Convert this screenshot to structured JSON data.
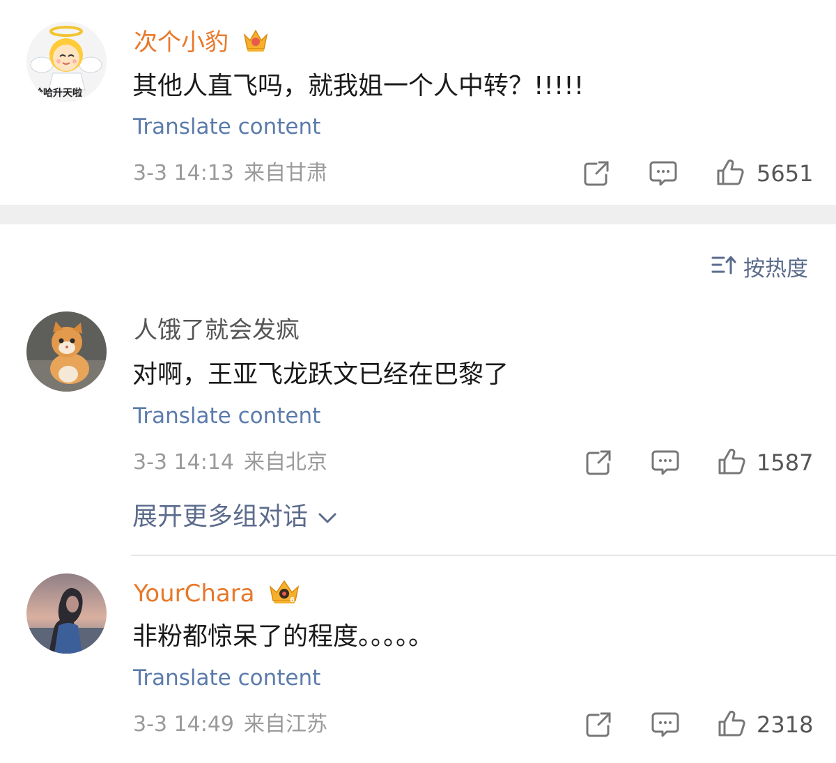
{
  "comments": [
    {
      "username": "次个小豹",
      "avatar_caption": "哈哈升天啦",
      "text": "其他人直飞吗，就我姐一个人中转？!!!!!",
      "translate": "Translate content",
      "time": "3-3 14:13",
      "location": "来自甘肃",
      "likes": "5651",
      "vip": true
    },
    {
      "username": "人饿了就会发疯",
      "text": "对啊，王亚飞龙跃文已经在巴黎了",
      "translate": "Translate content",
      "time": "3-3 14:14",
      "location": "来自北京",
      "likes": "1587",
      "vip": false
    },
    {
      "username": "YourChara",
      "crown_level": "6",
      "text": "非粉都惊呆了的程度。。。。。",
      "translate": "Translate content",
      "time": "3-3 14:49",
      "location": "来自江苏",
      "likes": "2318",
      "vip": true
    }
  ],
  "sort": {
    "label": "按热度",
    "icon": "sort-icon"
  },
  "expand_more": {
    "label": "展开更多组对话",
    "icon": "chevron-down-icon"
  },
  "icons": [
    "share-icon",
    "comment-icon",
    "like-icon",
    "crown-icon"
  ],
  "colors": {
    "vip_name": "#e8782a",
    "link": "#5b7bab",
    "meta": "#9a9a9a",
    "divider": "#efefef"
  }
}
